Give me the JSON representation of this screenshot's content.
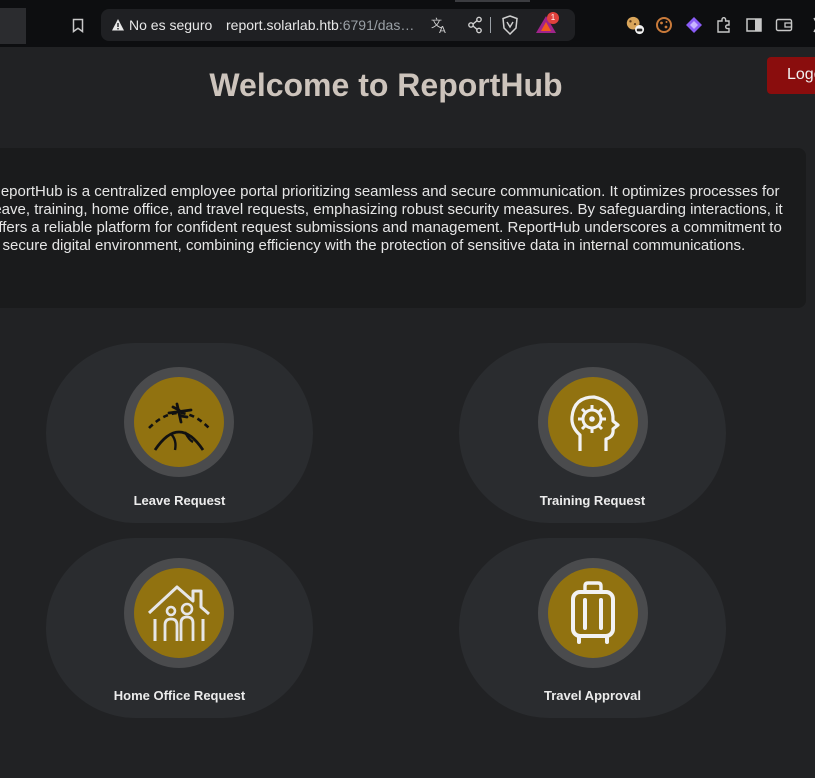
{
  "browser": {
    "security_label": "No es seguro",
    "url_host": "report.solarlab.htb",
    "url_rest": ":6791/das…",
    "rewards_badge": "1"
  },
  "page": {
    "title": "Welcome to ReportHub",
    "logout_label": "Logout",
    "intro": "ReportHub is a centralized employee portal prioritizing seamless and secure communication. It optimizes processes for leave, training, home office, and travel requests, emphasizing robust security measures. By safeguarding interactions, it offers a reliable platform for confident request submissions and management. ReportHub underscores a commitment to a secure digital environment, combining efficiency with the protection of sensitive data in internal communications."
  },
  "cards": [
    {
      "label": "Leave Request",
      "icon": "plane-over-globe-icon"
    },
    {
      "label": "Training Request",
      "icon": "head-gear-icon"
    },
    {
      "label": "Home Office Request",
      "icon": "home-family-icon"
    },
    {
      "label": "Travel Approval",
      "icon": "luggage-icon"
    }
  ],
  "colors": {
    "background": "#212224",
    "card": "#2a2c2f",
    "icon_fill": "#917210",
    "logout": "#8a0d0d",
    "title": "#cdc4bc"
  }
}
